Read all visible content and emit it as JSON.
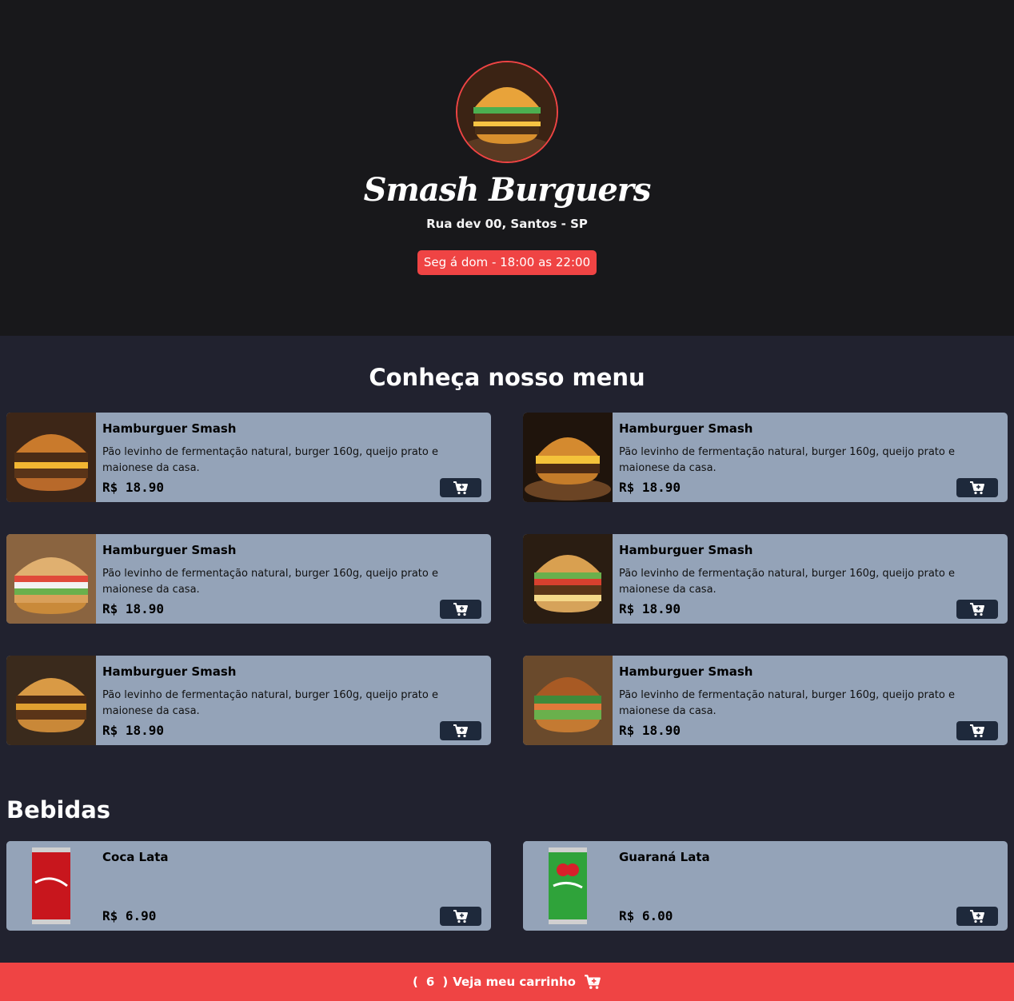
{
  "header": {
    "title": "Smash Burguers",
    "address": "Rua dev 00, Santos - SP",
    "hours": "Seg á dom - 18:00 as 22:00",
    "logo_icon": "burger-logo-image"
  },
  "menu": {
    "title": "Conheça nosso menu",
    "items": [
      {
        "name": "Hamburguer Smash",
        "description": "Pão levinho de fermentação natural, burger 160g, queijo prato e maionese da casa.",
        "price": "R$ 18.90"
      },
      {
        "name": "Hamburguer Smash",
        "description": "Pão levinho de fermentação natural, burger 160g, queijo prato e maionese da casa.",
        "price": "R$ 18.90"
      },
      {
        "name": "Hamburguer Smash",
        "description": "Pão levinho de fermentação natural, burger 160g, queijo prato e maionese da casa.",
        "price": "R$ 18.90"
      },
      {
        "name": "Hamburguer Smash",
        "description": "Pão levinho de fermentação natural, burger 160g, queijo prato e maionese da casa.",
        "price": "R$ 18.90"
      },
      {
        "name": "Hamburguer Smash",
        "description": "Pão levinho de fermentação natural, burger 160g, queijo prato e maionese da casa.",
        "price": "R$ 18.90"
      },
      {
        "name": "Hamburguer Smash",
        "description": "Pão levinho de fermentação natural, burger 160g, queijo prato e maionese da casa.",
        "price": "R$ 18.90"
      }
    ]
  },
  "drinks": {
    "title": "Bebidas",
    "items": [
      {
        "name": "Coca Lata",
        "price": "R$ 6.90"
      },
      {
        "name": "Guaraná Lata",
        "price": "R$ 6.00"
      }
    ]
  },
  "cart": {
    "count": "6",
    "open_paren": "(",
    "close_paren": ")",
    "label": "Veja meu carrinho",
    "icon": "cart-plus-icon"
  },
  "colors": {
    "accent": "#ef4444",
    "hero_bg": "#18181b",
    "page_bg": "#21222f",
    "card_bg": "#94a3b8",
    "button_bg": "#1e293b"
  }
}
